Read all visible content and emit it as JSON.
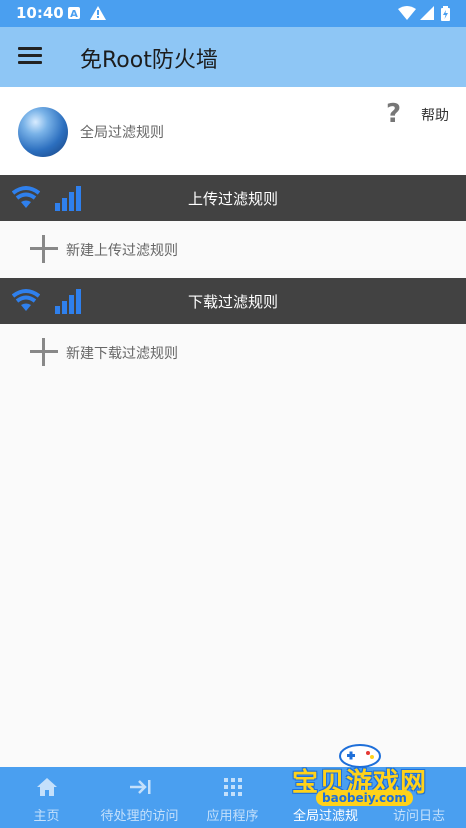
{
  "status_bar": {
    "time": "10:40"
  },
  "app_bar": {
    "title": "免Root防火墙",
    "menu_icon": "hamburger-menu-icon"
  },
  "global_rules": {
    "label": "全局过滤规则",
    "help_label": "帮助",
    "help_icon": "?"
  },
  "upload": {
    "title": "上传过滤规则",
    "add_label": "新建上传过滤规则"
  },
  "download": {
    "title": "下载过滤规则",
    "add_label": "新建下载过滤规则"
  },
  "bottom_nav": {
    "items": [
      {
        "label": "主页",
        "icon": "home-icon"
      },
      {
        "label": "待处理的访问",
        "icon": "arrow-to-line-icon"
      },
      {
        "label": "应用程序",
        "icon": "grid-icon"
      },
      {
        "label": "全局过滤规",
        "icon": "filter-icon"
      },
      {
        "label": "访问日志",
        "icon": "log-icon"
      }
    ]
  },
  "watermark": {
    "text": "宝贝游戏网",
    "url": "baobeiy.com"
  },
  "colors": {
    "status_bar": "#4a9ff0",
    "app_bar": "#8ec6f5",
    "section_header": "#424242",
    "bottom_nav": "#4a9ff0",
    "accent_blue": "#2f80ed"
  }
}
